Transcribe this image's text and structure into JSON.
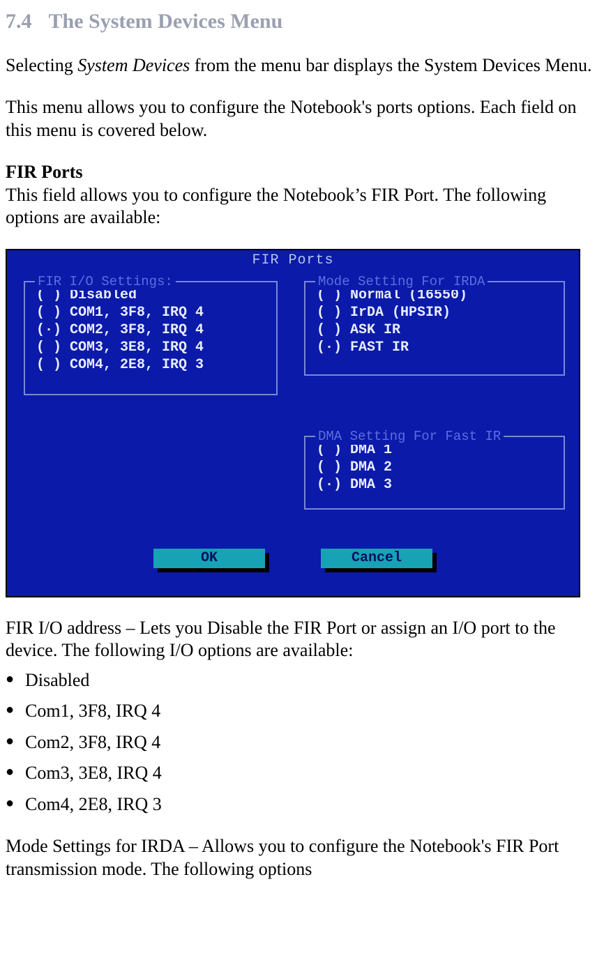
{
  "heading": {
    "number": "7.4",
    "title": "The System Devices Menu"
  },
  "intro1_a": "Selecting ",
  "intro1_i": "System Devices",
  "intro1_b": " from the menu bar displays the System Devices Menu.",
  "intro2": "This menu allows you to configure the Notebook's ports options. Each field on this menu is covered below.",
  "fir_heading": "FIR Ports",
  "fir_desc": "This field allows you to configure the Notebook’s FIR Port. The following options are available:",
  "bios": {
    "title": "FIR Ports",
    "io": {
      "legend": "FIR I/O Settings:",
      "rows": [
        "( ) Disabled",
        "( ) COM1, 3F8, IRQ 4",
        "(·) COM2, 3F8, IRQ 4",
        "( ) COM3, 3E8, IRQ 4",
        "( ) COM4, 2E8, IRQ 3"
      ]
    },
    "mode": {
      "legend": "Mode Setting For IRDA",
      "rows": [
        "( ) Normal (16550)",
        "( ) IrDA (HPSIR)",
        "( ) ASK IR",
        "(·) FAST IR"
      ]
    },
    "dma": {
      "legend": "DMA Setting For Fast IR",
      "rows": [
        "( ) DMA 1",
        "( ) DMA 2",
        "(·) DMA 3"
      ]
    },
    "ok": "OK",
    "cancel": "Cancel"
  },
  "after1": "FIR I/O address – Lets you Disable the FIR Port or assign an I/O port to the device. The following I/O options are available:",
  "bullets": [
    "Disabled",
    "Com1, 3F8, IRQ 4",
    "Com2, 3F8, IRQ 4",
    "Com3, 3E8, IRQ 4",
    "Com4, 2E8, IRQ 3"
  ],
  "after2": "Mode Settings for IRDA – Allows you to configure the Notebook's FIR Port transmission mode. The following options"
}
